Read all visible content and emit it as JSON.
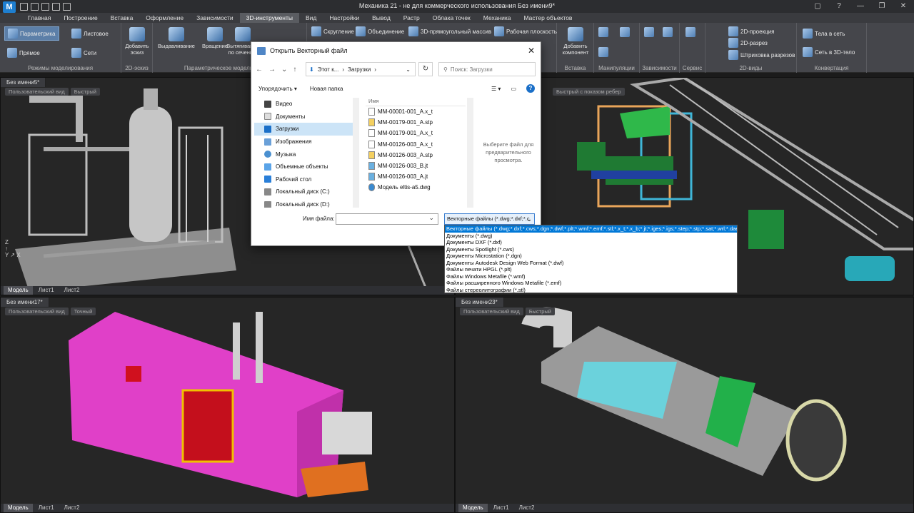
{
  "window": {
    "title": "Механика 21 - не для коммерческого использования Без имени9*",
    "buttons": [
      "▢",
      "?",
      "—",
      "❐",
      "✕"
    ]
  },
  "menu": [
    "Главная",
    "Построение",
    "Вставка",
    "Оформление",
    "Зависимости",
    "3D-инструменты",
    "Вид",
    "Настройки",
    "Вывод",
    "Растр",
    "Облака точек",
    "Механика",
    "Мастер объектов"
  ],
  "menu_active_index": 5,
  "ribbon": {
    "modeling": {
      "label": "Режимы моделирования",
      "parametric": "Параметрика",
      "direct": "Прямое",
      "sheet": "Листовое",
      "mesh": "Сети"
    },
    "sketch": {
      "label": "2D-эскиз",
      "add_sketch": "Добавить эскиз"
    },
    "param_model": {
      "label": "Параметрическое моделирование",
      "extrude": "Выдавливание",
      "revolve": "Вращение",
      "sweep": "Вытягивание по сечени..."
    },
    "ops": {
      "fillet": "Скругление",
      "union": "Объединение",
      "rect_array": "3D-прямоугольный массив",
      "workplane": "Рабочая плоскость"
    },
    "insert": {
      "label": "Вставка",
      "add_component": "Добавить компонент"
    },
    "manip": {
      "label": "Манипуляции"
    },
    "deps": {
      "label": "Зависимости"
    },
    "service": {
      "label": "Сервис"
    },
    "views2d": {
      "label": "2D-виды",
      "projection": "2D-проекция",
      "section": "2D-разрез",
      "hatch": "Штриховка разрезов"
    },
    "convert": {
      "label": "Конвертация",
      "bodies_to_mesh": "Тела в сеть",
      "mesh_to_3d": "Сеть в 3D-тело"
    }
  },
  "viewports": [
    {
      "tab": "Без имени5*",
      "view": "Пользовательский вид",
      "mode": "Быстрый",
      "sheets": [
        "Модель",
        "Лист1",
        "Лист2"
      ]
    },
    {
      "tab": "",
      "view": "",
      "mode": "Быстрый с показом ребер",
      "sheets": []
    },
    {
      "tab": "Без имени17*",
      "view": "Пользовательский вид",
      "mode": "Точный",
      "sheets": [
        "Модель",
        "Лист1",
        "Лист2"
      ]
    },
    {
      "tab": "Без имени23*",
      "view": "Пользовательский вид",
      "mode": "Быстрый",
      "sheets": [
        "Модель",
        "Лист1",
        "Лист2"
      ]
    }
  ],
  "dialog": {
    "title": "Открыть Векторный файл",
    "breadcrumb": [
      "Этот к...",
      "Загрузки"
    ],
    "search_placeholder": "Поиск: Загрузки",
    "organize": "Упорядочить",
    "new_folder": "Новая папка",
    "nav": [
      "Видео",
      "Документы",
      "Загрузки",
      "Изображения",
      "Музыка",
      "Объемные объекты",
      "Рабочий стол",
      "Локальный диск (C:)",
      "Локальный диск (D:)"
    ],
    "nav_selected_index": 2,
    "files_header": "Имя",
    "files": [
      "MM-00001-001_A.x_t",
      "MM-00179-001_A.stp",
      "MM-00179-001_A.x_t",
      "MM-00126-003_A.x_t",
      "MM-00126-003_A.stp",
      "MM-00126-003_B.jt",
      "MM-00126-003_A.jt",
      "Модель eltis-a5.dwg"
    ],
    "preview_text": "Выберите файл для предварительного просмотра.",
    "filename_label": "Имя файла:",
    "filetype_value": "Векторные файлы (*.dwg;*.dxf;*.c"
  },
  "filetype_options": [
    "Векторные файлы (*.dwg;*.dxf;*.cws;*.dgn;*.dwf;*.plt;*.wmf;*.emf;*.stl;*.x_t;*.x_b;*.jt;*.iges;*.igs;*.step;*.stp;*.sat;*.wrl;*.dae;*.c3d)",
    "Документы (*.dwg)",
    "Документы DXF (*.dxf)",
    "Документы Spotlight (*.cws)",
    "Документы Microstation (*.dgn)",
    "Документы Autodesk Design Web Format (*.dwf)",
    "Файлы печати HPGL (*.plt)",
    "Файлы Windows Metafile (*.wmf)",
    "Файлы расширенного Windows Metafile (*.emf)",
    "Файлы стереолитографии (*.stl)"
  ],
  "filetype_selected_index": 0,
  "colors": {
    "accent": "#0078d7",
    "ribbon": "#45464b",
    "viewport_bg": "#262626",
    "container_pink": "#e040c8",
    "conveyor_green": "#2fb84a"
  }
}
